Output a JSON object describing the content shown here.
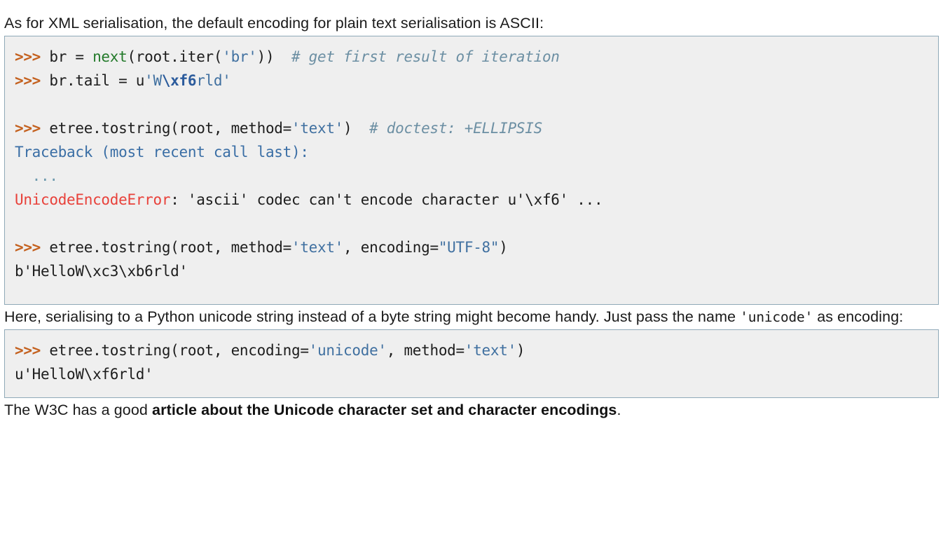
{
  "paragraphs": {
    "intro": "As for XML serialisation, the default encoding for plain text serialisation is ASCII:",
    "mid_part1": "Here, serialising to a Python unicode string instead of a byte string might become handy. Just pass the name ",
    "mid_code": "'unicode'",
    "mid_part2": " as encoding:",
    "final_part1": "The W3C has a good ",
    "final_link": "article about the Unicode character set and character encodings",
    "final_part2": "."
  },
  "code_block_1": {
    "line1": {
      "prompt": ">>>",
      "plain1": " br = ",
      "builtin": "next",
      "plain2": "(root.iter(",
      "str1": "'br'",
      "plain3": "))  ",
      "comment": "# get first result of iteration"
    },
    "line2": {
      "prompt": ">>>",
      "plain1": " br.tail = u",
      "str1": "'W",
      "esc": "\\xf6",
      "str2": "rld'"
    },
    "line3": "",
    "line4": {
      "prompt": ">>>",
      "plain1": " etree.tostring(root, method=",
      "str1": "'text'",
      "plain2": ")  ",
      "comment": "# doctest: +ELLIPSIS"
    },
    "line5": {
      "trace": "Traceback (most recent call last):"
    },
    "line6": {
      "ellipsis": "  ..."
    },
    "line7": {
      "err": "UnicodeEncodeError",
      "plain": ": 'ascii' codec can't encode character u'\\xf6' ..."
    },
    "line8": "",
    "line9": {
      "prompt": ">>>",
      "plain1": " etree.tostring(root, method=",
      "str1": "'text'",
      "plain2": ", encoding=",
      "str2": "\"UTF-8\"",
      "plain3": ")"
    },
    "line10": {
      "plain": "b'HelloW\\xc3\\xb6rld'"
    }
  },
  "code_block_2": {
    "line1": {
      "prompt": ">>>",
      "plain1": " etree.tostring(root, encoding=",
      "str1": "'unicode'",
      "plain2": ", method=",
      "str2": "'text'",
      "plain3": ")"
    },
    "line2": {
      "plain": "u'HelloW\\xf6rld'"
    }
  },
  "colors": {
    "code_background": "#efefef",
    "code_border": "#8fa9b8",
    "prompt": "#c4611f",
    "string": "#4070a0",
    "builtin": "#237a2a",
    "comment": "#6c8fa3",
    "traceback": "#3a6ea5",
    "error": "#e8413a",
    "escape": "#2b5b9c",
    "body_text": "#1a1a1a"
  }
}
